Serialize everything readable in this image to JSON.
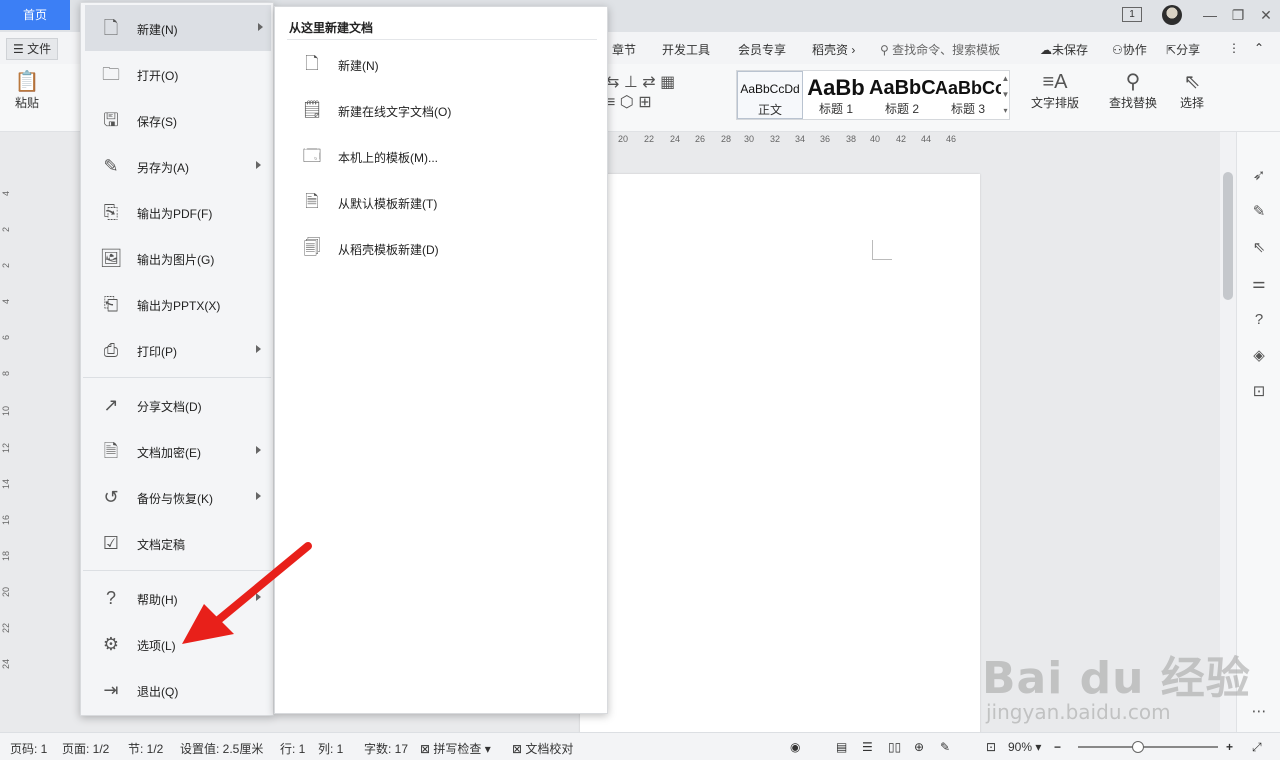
{
  "titlebar": {
    "home_tab": "首页",
    "page_indicator": "1"
  },
  "menubar": {
    "file_label": "文件",
    "tabs": [
      "章节",
      "开发工具",
      "会员专享",
      "稻壳资"
    ],
    "search_placeholder": "查找命令、搜索模板",
    "unsaved": "未保存",
    "collab": "协作",
    "share": "分享"
  },
  "ribbon": {
    "paste": "粘贴",
    "text_layout": "文字排版",
    "find_replace": "查找替换",
    "select": "选择",
    "styles": [
      {
        "sample": "AaBbCcDd",
        "name": "正文"
      },
      {
        "sample": "AaBb",
        "name": "标题 1"
      },
      {
        "sample": "AaBbC",
        "name": "标题 2"
      },
      {
        "sample": "AaBbCc",
        "name": "标题 3"
      }
    ]
  },
  "ruler": {
    "h_ticks": [
      "20",
      "22",
      "24",
      "26",
      "28",
      "30",
      "32",
      "34",
      "36",
      "38",
      "40",
      "42",
      "44",
      "46"
    ],
    "v_ticks": [
      "4",
      "2",
      "2",
      "4",
      "6",
      "8",
      "10",
      "12",
      "14",
      "16",
      "18",
      "20",
      "22",
      "24"
    ]
  },
  "file_menu": {
    "items": [
      {
        "label": "新建(N)",
        "icon": "new-doc-icon",
        "submenu": true
      },
      {
        "label": "打开(O)",
        "icon": "folder-icon",
        "submenu": false
      },
      {
        "label": "保存(S)",
        "icon": "save-icon",
        "submenu": false
      },
      {
        "label": "另存为(A)",
        "icon": "save-as-icon",
        "submenu": true
      },
      {
        "label": "输出为PDF(F)",
        "icon": "pdf-icon",
        "submenu": false
      },
      {
        "label": "输出为图片(G)",
        "icon": "image-export-icon",
        "submenu": false
      },
      {
        "label": "输出为PPTX(X)",
        "icon": "pptx-icon",
        "submenu": false
      },
      {
        "label": "打印(P)",
        "icon": "printer-icon",
        "submenu": true
      },
      {
        "label": "分享文档(D)",
        "icon": "share-icon",
        "submenu": false
      },
      {
        "label": "文档加密(E)",
        "icon": "encrypt-icon",
        "submenu": true
      },
      {
        "label": "备份与恢复(K)",
        "icon": "backup-icon",
        "submenu": true
      },
      {
        "label": "文档定稿",
        "icon": "finalize-icon",
        "submenu": false
      },
      {
        "label": "帮助(H)",
        "icon": "help-icon",
        "submenu": true
      },
      {
        "label": "选项(L)",
        "icon": "gear-icon",
        "submenu": false
      },
      {
        "label": "退出(Q)",
        "icon": "exit-icon",
        "submenu": false
      }
    ]
  },
  "submenu": {
    "header": "从这里新建文档",
    "items": [
      {
        "label": "新建(N)",
        "icon": "blank-doc-icon"
      },
      {
        "label": "新建在线文字文档(O)",
        "icon": "online-doc-icon"
      },
      {
        "label": "本机上的模板(M)...",
        "icon": "local-template-icon"
      },
      {
        "label": "从默认模板新建(T)",
        "icon": "default-template-icon"
      },
      {
        "label": "从稻壳模板新建(D)",
        "icon": "docer-template-icon"
      }
    ]
  },
  "statusbar": {
    "page_no": "页码: 1",
    "pages": "页面: 1/2",
    "section": "节: 1/2",
    "setting": "设置值: 2.5厘米",
    "row": "行: 1",
    "col": "列: 1",
    "words": "字数: 17",
    "spell": "拼写检查",
    "proof": "文档校对",
    "zoom": "90%"
  },
  "watermark": {
    "big": "Bai du 经验",
    "small": "jingyan.baidu.com"
  },
  "colors": {
    "accent": "#3c7ff5",
    "arrow": "#e8201a"
  }
}
